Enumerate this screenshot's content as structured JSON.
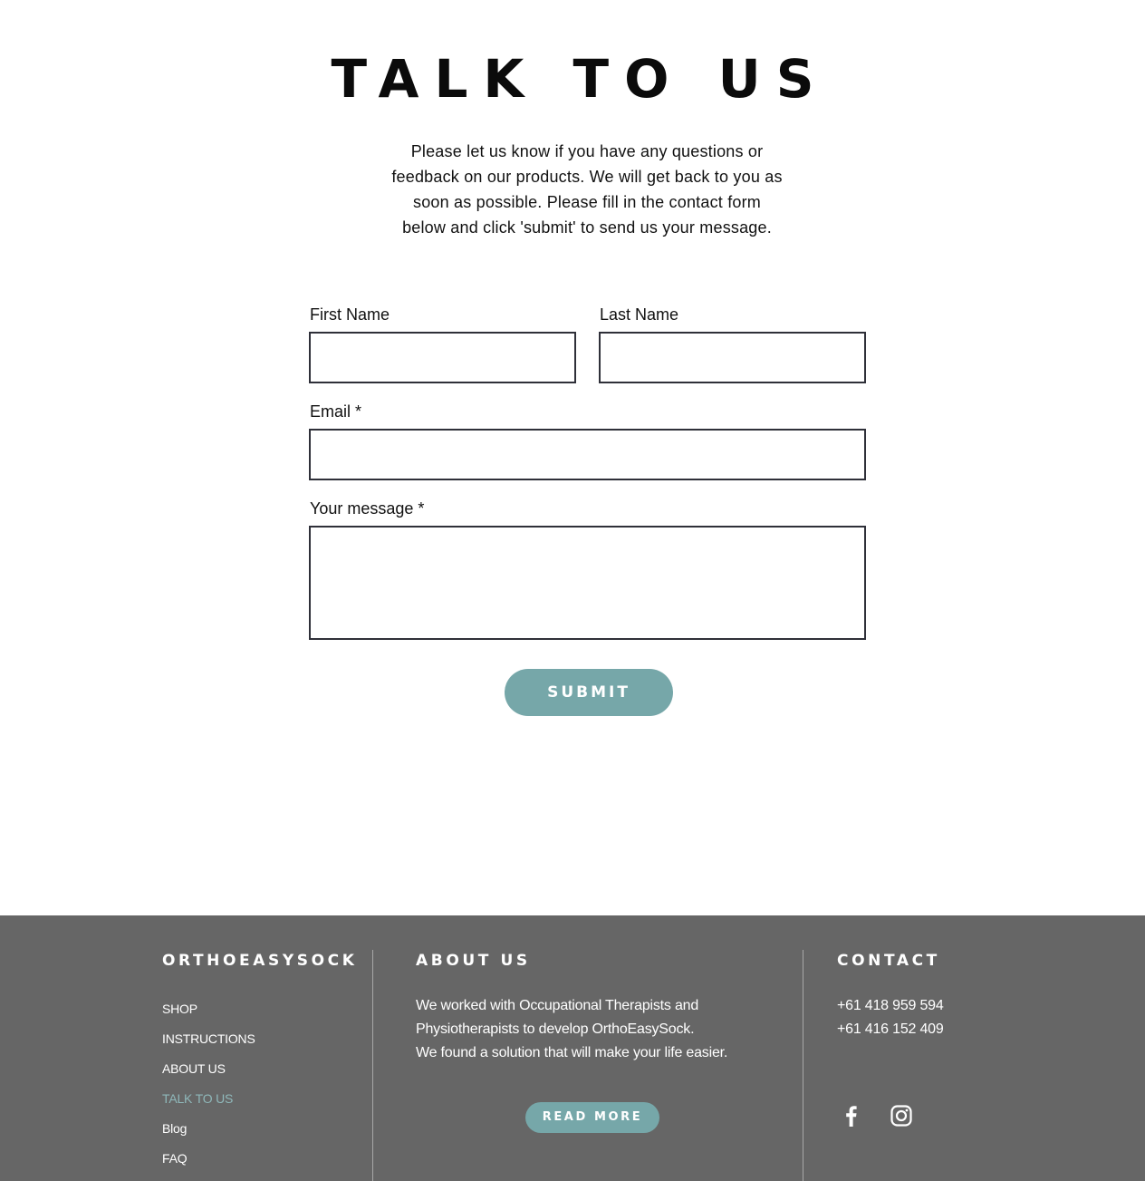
{
  "page": {
    "title": "TALK TO US",
    "intro_lines": [
      "Please let us know if you have any questions or",
      "feedback on our products. We will get back to you as",
      "soon as possible. Please fill in the contact form",
      "below and click 'submit' to send us your message."
    ]
  },
  "form": {
    "first_name_label": "First Name",
    "first_name_value": "",
    "last_name_label": "Last Name",
    "last_name_value": "",
    "email_label": "Email *",
    "email_value": "",
    "message_label": "Your message *",
    "message_value": "",
    "submit_label": "SUBMIT"
  },
  "footer": {
    "brand": "ORTHOEASYSOCK",
    "nav_items": [
      {
        "label": "SHOP"
      },
      {
        "label": "INSTRUCTIONS"
      },
      {
        "label": "ABOUT US"
      },
      {
        "label": "TALK TO US",
        "active": true
      },
      {
        "label": "Blog"
      },
      {
        "label": "FAQ"
      }
    ],
    "about_heading": "ABOUT US",
    "about_lines": [
      "We worked with Occupational Therapists and",
      "Physiotherapists to develop OrthoEasySock.",
      "We found a solution that will make your life easier."
    ],
    "read_more_label": "READ MORE",
    "contact_heading": "CONTACT",
    "phones": [
      "+61 418 959 594",
      "+61 416 152 409"
    ],
    "social_icons": [
      "facebook-icon",
      "instagram-icon"
    ]
  },
  "colors": {
    "accent": "#76a7a9",
    "footer_bg": "#666666",
    "active_nav": "#8fb8ba",
    "field_border": "#2f3039"
  }
}
